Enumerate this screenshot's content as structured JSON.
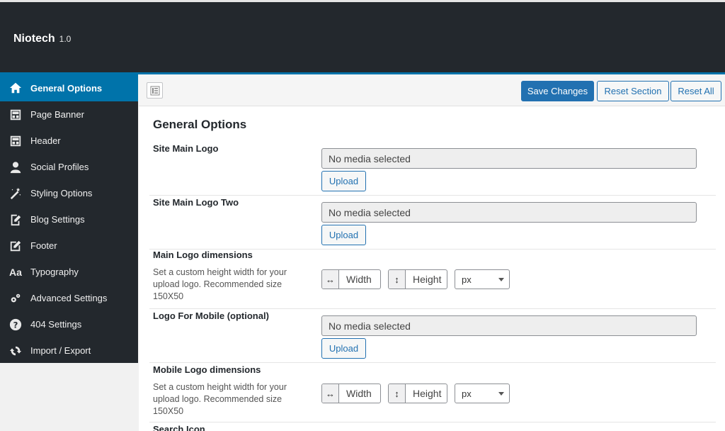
{
  "app": {
    "name": "Niotech",
    "version": "1.0"
  },
  "sidebar": {
    "items": [
      {
        "label": "General Options",
        "icon": "home-icon",
        "active": true
      },
      {
        "label": "Page Banner",
        "icon": "layout-icon"
      },
      {
        "label": "Header",
        "icon": "layout-icon"
      },
      {
        "label": "Social Profiles",
        "icon": "user-icon"
      },
      {
        "label": "Styling Options",
        "icon": "magic-wand-icon"
      },
      {
        "label": "Blog Settings",
        "icon": "edit-page-icon"
      },
      {
        "label": "Footer",
        "icon": "edit-icon"
      },
      {
        "label": "Typography",
        "icon": "font-icon",
        "glyph": "Aa"
      },
      {
        "label": "Advanced Settings",
        "icon": "gears-icon"
      },
      {
        "label": "404 Settings",
        "icon": "question-icon"
      },
      {
        "label": "Import / Export",
        "icon": "refresh-icon"
      }
    ]
  },
  "toolbar": {
    "save_label": "Save Changes",
    "reset_section_label": "Reset Section",
    "reset_all_label": "Reset All"
  },
  "main": {
    "title": "General Options",
    "fields": {
      "site_logo": {
        "label": "Site Main Logo",
        "value": "No media selected",
        "upload": "Upload"
      },
      "site_logo_two": {
        "label": "Site Main Logo Two",
        "value": "No media selected",
        "upload": "Upload"
      },
      "logo_dim": {
        "label": "Main Logo dimensions",
        "desc": "Set a custom height width for your upload logo. Recommended size 150X50",
        "width_placeholder": "Width",
        "height_placeholder": "Height",
        "unit": "px"
      },
      "mobile_logo": {
        "label": "Logo For Mobile (optional)",
        "value": "No media selected",
        "upload": "Upload"
      },
      "mobile_dim": {
        "label": "Mobile Logo dimensions",
        "desc": "Set a custom height width for your upload logo. Recommended size 150X50",
        "width_placeholder": "Width",
        "height_placeholder": "Height",
        "unit": "px"
      },
      "search_icon": {
        "label": "Search Icon"
      }
    }
  },
  "colors": {
    "accent": "#0073aa",
    "dark": "#23282d"
  }
}
